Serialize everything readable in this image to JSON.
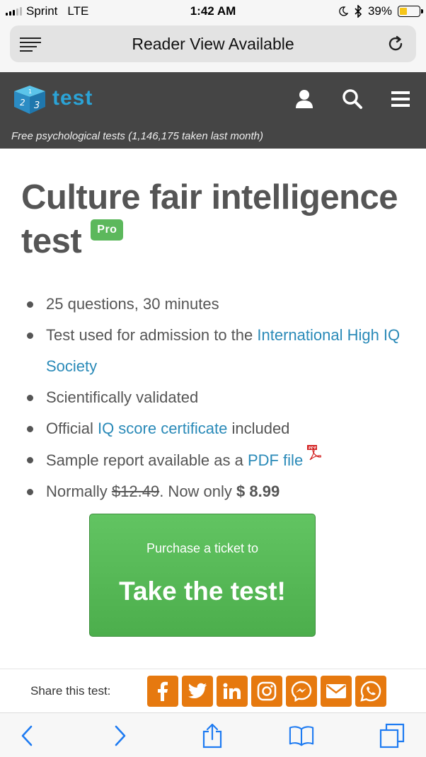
{
  "status": {
    "carrier": "Sprint",
    "network": "LTE",
    "time": "1:42 AM",
    "battery_percent": "39%",
    "battery_level": 0.39,
    "battery_color": "#f5c518"
  },
  "browser": {
    "address_title": "Reader View Available",
    "icons": [
      "reader-icon",
      "reload-icon"
    ]
  },
  "header": {
    "logo_text": "test",
    "tagline": "Free psychological tests (1,146,175 taken last month)",
    "logo_color": "#2ba3d6",
    "icons": [
      "user-icon",
      "search-icon",
      "menu-icon"
    ]
  },
  "main": {
    "title": "Culture fair intelligence test",
    "badge": "Pro",
    "features": {
      "f1": "25 questions, 30 minutes",
      "f2_prefix": "Test used for admission to the ",
      "f2_link": "International High IQ Society",
      "f3": "Scientifically validated",
      "f4_prefix": "Official ",
      "f4_link": "IQ score certificate",
      "f4_suffix": " included",
      "f5_prefix": "Sample report available as a ",
      "f5_link": "PDF file",
      "f6_prefix": "Normally ",
      "f6_old_price": "$12.49",
      "f6_mid": ". Now only ",
      "f6_price": "$ 8.99"
    },
    "cta": {
      "small": "Purchase a ticket to",
      "big": "Take the test!"
    }
  },
  "share": {
    "label": "Share this test:",
    "icons": [
      "facebook-icon",
      "twitter-icon",
      "linkedin-icon",
      "instagram-icon",
      "messenger-icon",
      "email-icon",
      "whatsapp-icon"
    ],
    "color": "#e6790f"
  },
  "toolbar": {
    "icons": [
      "back-icon",
      "forward-icon",
      "share-icon",
      "bookmarks-icon",
      "tabs-icon"
    ]
  }
}
